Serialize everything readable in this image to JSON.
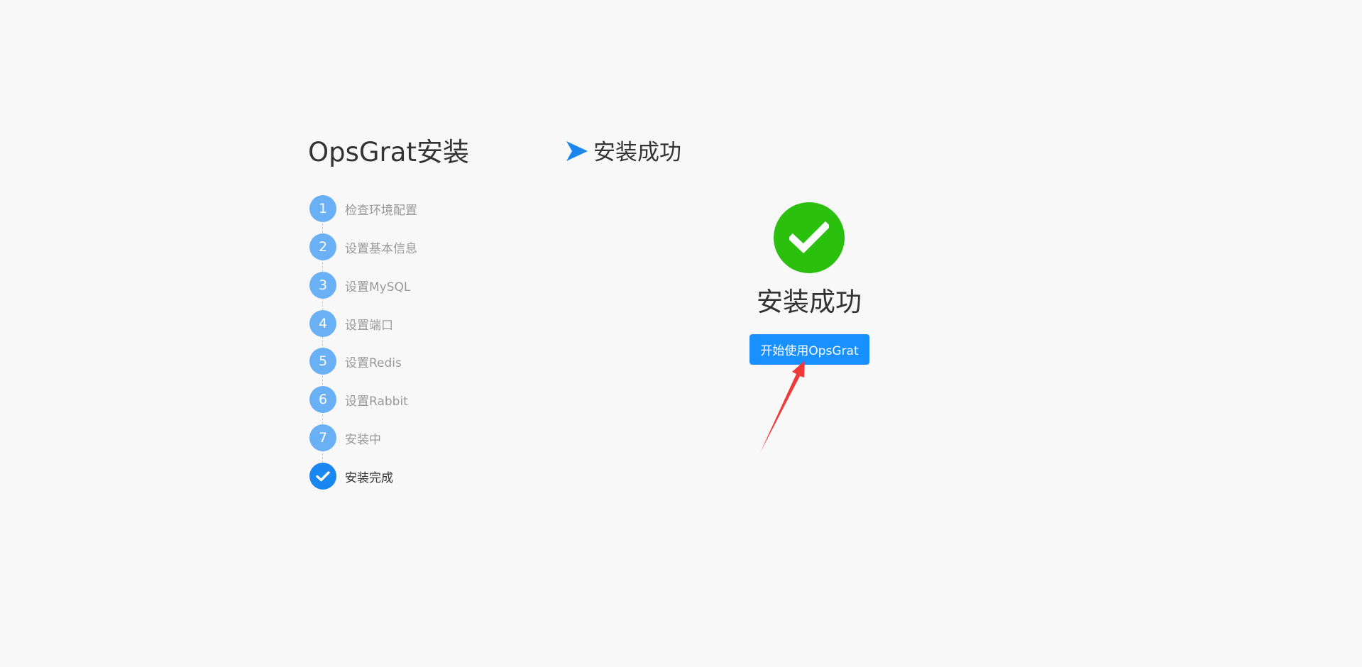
{
  "app": {
    "title": "OpsGrat安装"
  },
  "steps": [
    {
      "marker": "1",
      "label": "检查环境配置",
      "status": "completed"
    },
    {
      "marker": "2",
      "label": "设置基本信息",
      "status": "completed"
    },
    {
      "marker": "3",
      "label": "设置MySQL",
      "status": "completed"
    },
    {
      "marker": "4",
      "label": "设置端口",
      "status": "completed"
    },
    {
      "marker": "5",
      "label": "设置Redis",
      "status": "completed"
    },
    {
      "marker": "6",
      "label": "设置Rabbit",
      "status": "completed"
    },
    {
      "marker": "7",
      "label": "安装中",
      "status": "completed"
    },
    {
      "marker": "check-icon",
      "label": "安装完成",
      "status": "current"
    }
  ],
  "section": {
    "title": "安装成功",
    "icon": "arrow-right-icon"
  },
  "result": {
    "icon": "check-circle-icon",
    "title": "安装成功",
    "button_label": "开始使用OpsGrat"
  },
  "colors": {
    "background": "#f8f8f8",
    "step_pending": "#6ab0f5",
    "step_current": "#1a86f0",
    "success": "#2bc00e",
    "primary_button": "#1890ff",
    "annotation_arrow": "#f03a3a"
  }
}
